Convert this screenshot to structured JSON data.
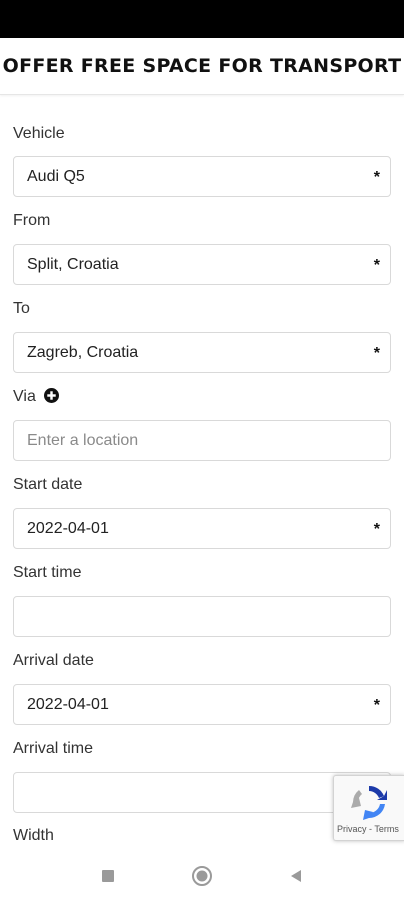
{
  "header": {
    "title": "OFFER FREE SPACE FOR TRANSPORT"
  },
  "form": {
    "vehicle": {
      "label": "Vehicle",
      "value": "Audi Q5",
      "required": "*"
    },
    "from": {
      "label": "From",
      "value": "Split, Croatia",
      "required": "*"
    },
    "to": {
      "label": "To",
      "value": "Zagreb, Croatia",
      "required": "*"
    },
    "via": {
      "label": "Via",
      "placeholder": "Enter a location",
      "icon": "plus-circle-icon"
    },
    "start_date": {
      "label": "Start date",
      "value": "2022-04-01",
      "required": "*"
    },
    "start_time": {
      "label": "Start time",
      "value": ""
    },
    "arrival_date": {
      "label": "Arrival date",
      "value": "2022-04-01",
      "required": "*"
    },
    "arrival_time": {
      "label": "Arrival time",
      "value": ""
    },
    "width": {
      "label": "Width"
    }
  },
  "recaptcha": {
    "links": "Privacy - Terms"
  },
  "nav": {
    "icons": [
      "recents-icon",
      "home-icon",
      "back-icon"
    ]
  }
}
